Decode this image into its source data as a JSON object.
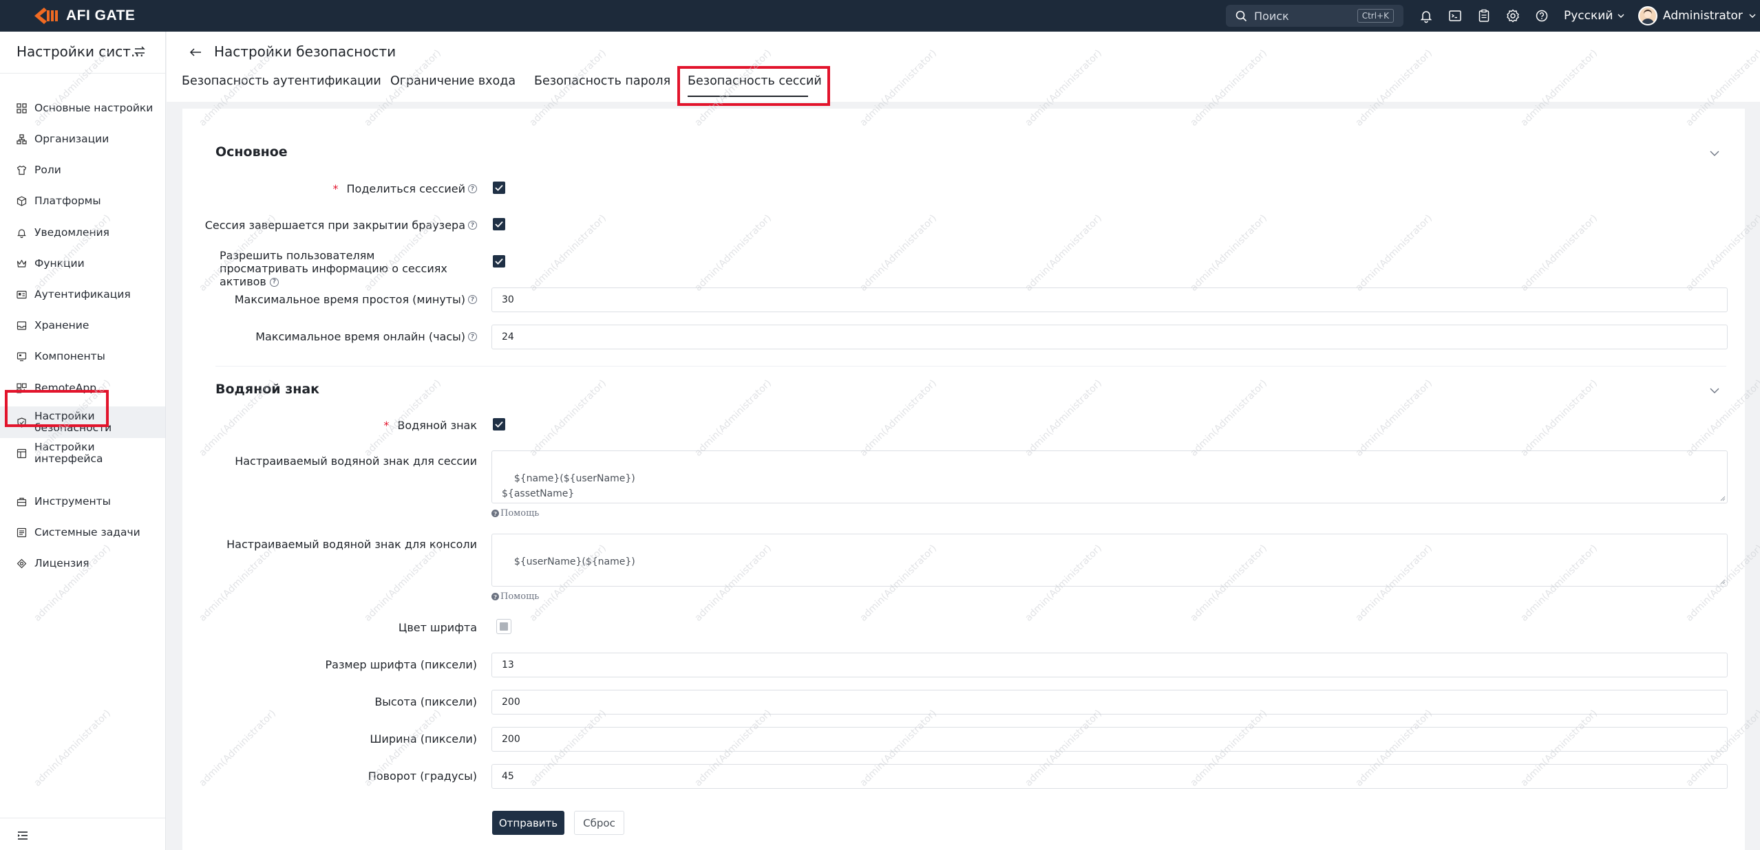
{
  "app": {
    "brand": "AFI GATE"
  },
  "topbar": {
    "search_placeholder": "Поиск",
    "search_shortcut": "Ctrl+K",
    "language": "Русский",
    "user": "Administrator"
  },
  "sidebar": {
    "title": "Настройки сист...",
    "items": [
      {
        "label": "Основные настройки"
      },
      {
        "label": "Организации"
      },
      {
        "label": "Роли"
      },
      {
        "label": "Платформы"
      },
      {
        "label": "Уведомления"
      },
      {
        "label": "Функции"
      },
      {
        "label": "Аутентификация"
      },
      {
        "label": "Хранение"
      },
      {
        "label": "Компоненты"
      },
      {
        "label": "RemoteApp"
      },
      {
        "label": "Настройки безопасности",
        "active": true
      },
      {
        "label": "Настройки интерфейса"
      },
      {
        "label": "Инструменты"
      },
      {
        "label": "Системные задачи"
      },
      {
        "label": "Лицензия"
      }
    ]
  },
  "page": {
    "title": "Настройки безопасности",
    "tabs": [
      {
        "label": "Безопасность аутентификации"
      },
      {
        "label": "Ограничение входа"
      },
      {
        "label": "Безопасность пароля"
      },
      {
        "label": "Безопасность сессий",
        "active": true
      }
    ]
  },
  "basic": {
    "title": "Основное",
    "share_session": {
      "label": "Поделиться сессией",
      "checked": true
    },
    "session_close": {
      "label": "Сессия завершается при закрытии браузера",
      "checked": true
    },
    "allow_view": {
      "label": "Разрешить пользователям просматривать информацию о сессиях активов",
      "checked": true
    },
    "max_idle": {
      "label": "Максимальное время простоя (минуты)",
      "value": "30"
    },
    "max_online": {
      "label": "Максимальное время онлайн (часы)",
      "value": "24"
    }
  },
  "watermark": {
    "title": "Водяной знак",
    "enabled": {
      "label": "Водяной знак",
      "checked": true
    },
    "session_wm": {
      "label": "Настраиваемый водяной знак для сессии",
      "value": "${name}(${userName})\n${assetName}",
      "help": "Помощь"
    },
    "console_wm": {
      "label": "Настраиваемый водяной знак для консоли",
      "value": "${userName}(${name})",
      "help": "Помощь"
    },
    "font_color": {
      "label": "Цвет шрифта",
      "color": "#aeb3ba"
    },
    "font_size": {
      "label": "Размер шрифта (пиксели)",
      "value": "13"
    },
    "height": {
      "label": "Высота (пиксели)",
      "value": "200"
    },
    "width": {
      "label": "Ширина (пиксели)",
      "value": "200"
    },
    "rotation": {
      "label": "Поворот (градусы)",
      "value": "45"
    },
    "overlay_text": "admin(Administrator)"
  },
  "actions": {
    "submit": "Отправить",
    "reset": "Сброс"
  },
  "colors": {
    "accent": "#1f3045",
    "topbar": "#1d2a3a",
    "highlight": "#e2142c"
  }
}
